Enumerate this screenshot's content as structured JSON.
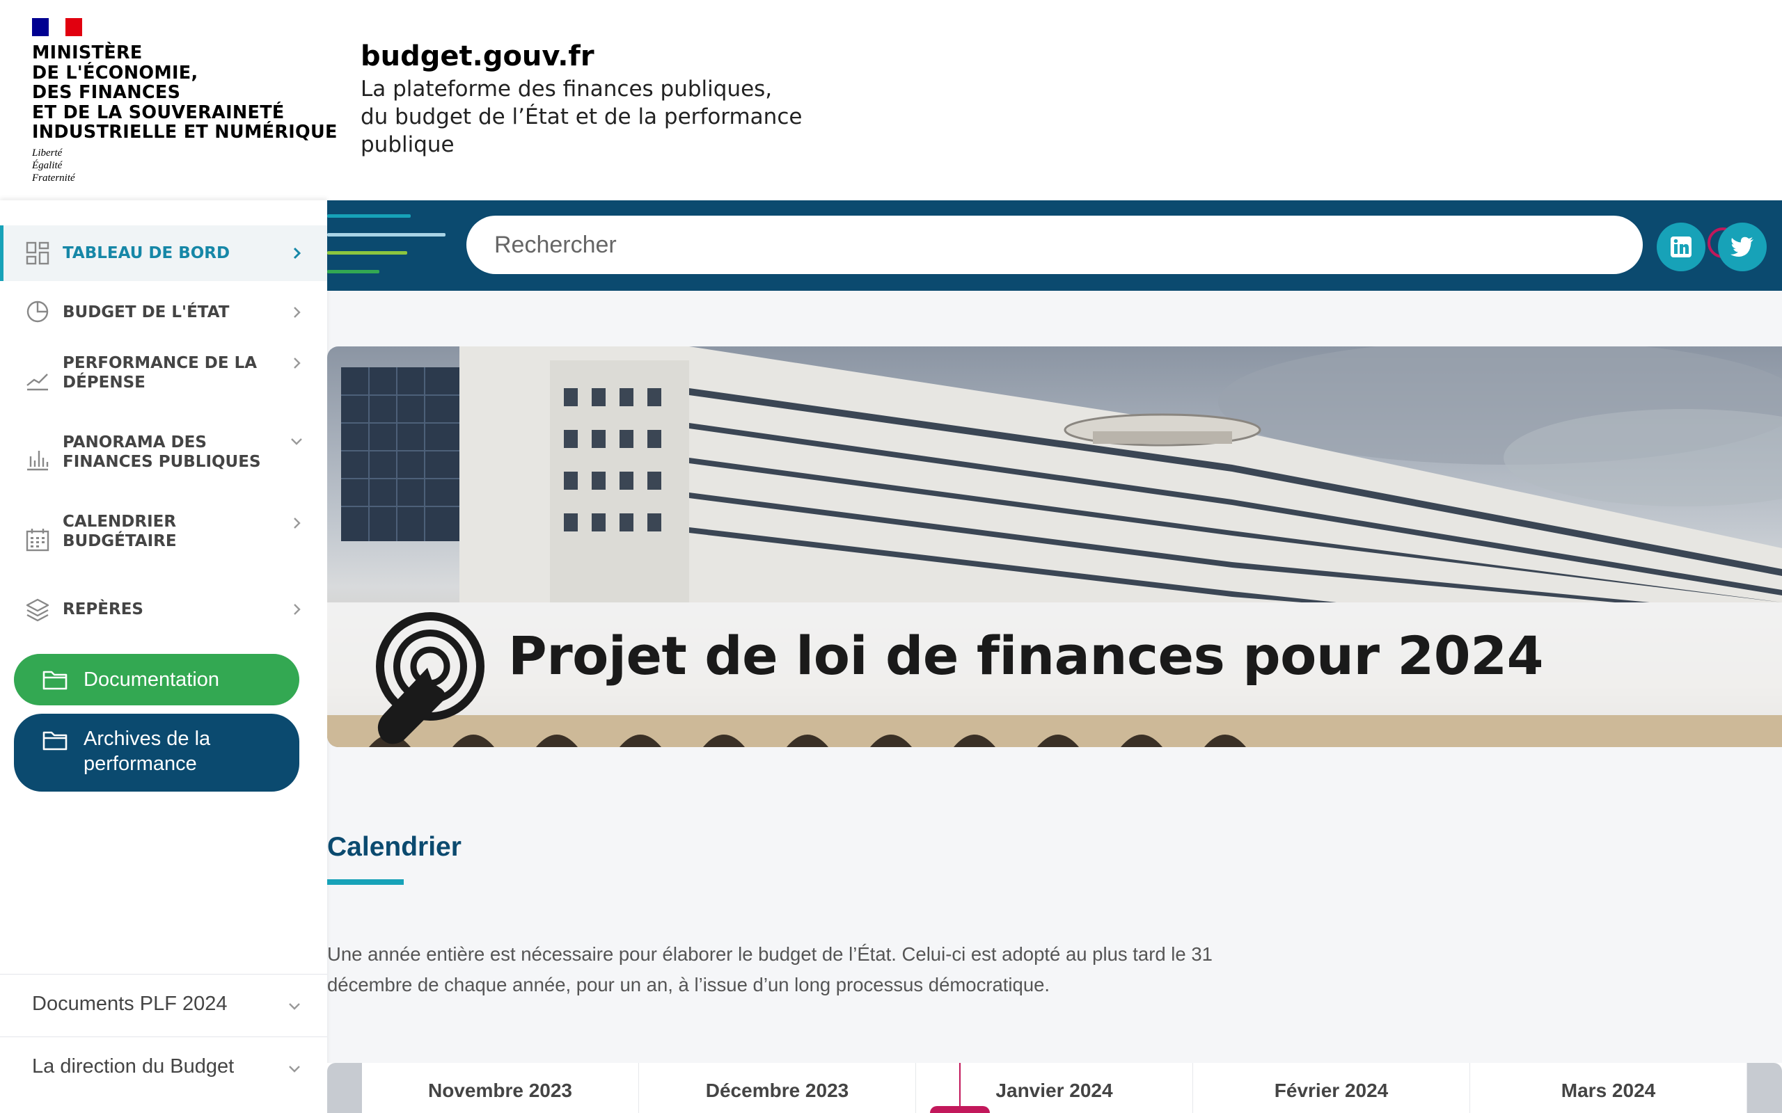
{
  "header": {
    "ministry_lines": [
      "MINISTÈRE",
      "DE L'ÉCONOMIE,",
      "DES FINANCES",
      "ET DE LA SOUVERAINETÉ",
      "INDUSTRIELLE ET NUMÉRIQUE"
    ],
    "motto_lines": [
      "Liberté",
      "Égalité",
      "Fraternité"
    ],
    "site_title": "budget.gouv.fr",
    "site_tagline": "La plateforme des finances publiques, du budget de l’État et de la performance publique"
  },
  "sidebar": {
    "items": [
      {
        "label": "TABLEAU DE BORD",
        "icon": "dashboard-icon",
        "active": true
      },
      {
        "label": "BUDGET DE L'ÉTAT",
        "icon": "pie-chart-icon"
      },
      {
        "label": "PERFORMANCE DE LA DÉPENSE",
        "icon": "trend-icon"
      },
      {
        "label": "PANORAMA DES FINANCES PUBLIQUES",
        "icon": "bar-chart-icon"
      },
      {
        "label": "CALENDRIER BUDGÉTAIRE",
        "icon": "calendar-icon"
      },
      {
        "label": "REPÈRES",
        "icon": "layers-icon"
      }
    ],
    "documentation_label": "Documentation",
    "archives_label": "Archives de la performance",
    "footer_items": [
      {
        "label": "Documents PLF 2024"
      },
      {
        "label": "La direction du Budget"
      }
    ]
  },
  "search": {
    "placeholder": "Rechercher"
  },
  "social": [
    "linkedin-icon",
    "twitter-icon"
  ],
  "hero": {
    "title": "Projet de loi de finances pour 2024"
  },
  "calendar": {
    "title": "Calendrier",
    "description": "Une année entière est nécessaire pour élaborer le budget de l’État. Celui-ci est adopté au plus tard le 31 décembre de chaque année, pour un an, à l’issue d’un long processus démocratique.",
    "months": [
      "Novembre 2023",
      "Décembre 2023",
      "Janvier 2024",
      "Février 2024",
      "Mars 2024"
    ]
  },
  "colors": {
    "primary": "#0b4a6f",
    "accent": "#17a2b8",
    "green": "#33a852",
    "marker": "#c2185b",
    "search_icon": "#c2185b"
  }
}
